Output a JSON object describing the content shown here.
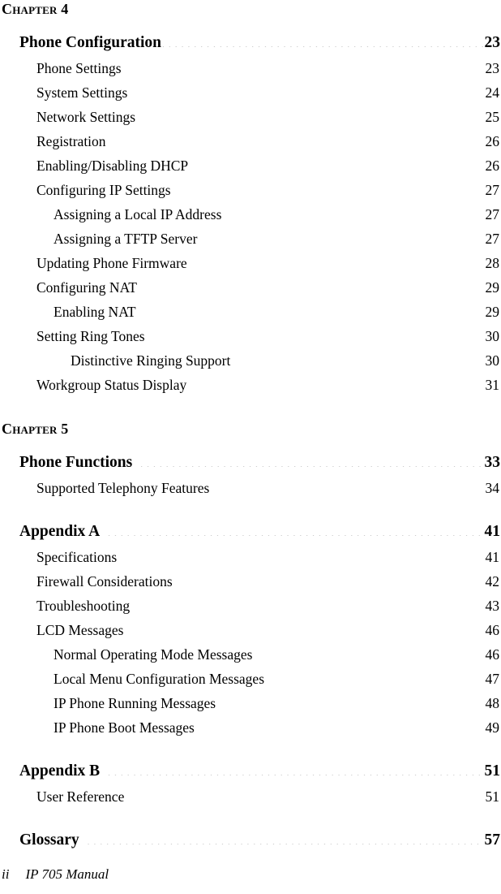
{
  "document": {
    "footer": {
      "page_number": "ii",
      "title": "IP 705 Manual"
    }
  },
  "toc": {
    "blocks": [
      {
        "chapter_label": "Chapter 4",
        "entries": [
          {
            "level": 0,
            "title": "Phone Configuration",
            "page": "23"
          },
          {
            "level": 1,
            "title": "Phone Settings",
            "page": "23"
          },
          {
            "level": 1,
            "title": "System Settings",
            "page": "24"
          },
          {
            "level": 1,
            "title": "Network Settings",
            "page": "25"
          },
          {
            "level": 1,
            "title": "Registration",
            "page": "26"
          },
          {
            "level": 1,
            "title": "Enabling/Disabling DHCP",
            "page": "26"
          },
          {
            "level": 1,
            "title": "Configuring IP Settings",
            "page": "27"
          },
          {
            "level": 2,
            "title": "Assigning a Local IP Address",
            "page": "27"
          },
          {
            "level": 2,
            "title": "Assigning a TFTP Server",
            "page": "27"
          },
          {
            "level": 1,
            "title": "Updating Phone Firmware",
            "page": "28"
          },
          {
            "level": 1,
            "title": "Configuring NAT",
            "page": "29"
          },
          {
            "level": 2,
            "title": "Enabling NAT",
            "page": "29"
          },
          {
            "level": 1,
            "title": "Setting Ring Tones",
            "page": "30"
          },
          {
            "level": 3,
            "title": "Distinctive Ringing Support",
            "page": "30"
          },
          {
            "level": 1,
            "title": "Workgroup Status Display",
            "page": "31"
          }
        ]
      },
      {
        "chapter_label": "Chapter 5",
        "entries": [
          {
            "level": 0,
            "title": "Phone Functions",
            "page": "33"
          },
          {
            "level": 1,
            "title": "Supported Telephony Features",
            "page": "34"
          }
        ]
      },
      {
        "chapter_label": null,
        "entries": [
          {
            "level": 0,
            "title": "Appendix A",
            "page": "41"
          },
          {
            "level": 1,
            "title": "Specifications",
            "page": "41"
          },
          {
            "level": 1,
            "title": "Firewall Considerations",
            "page": "42"
          },
          {
            "level": 1,
            "title": "Troubleshooting",
            "page": "43"
          },
          {
            "level": 1,
            "title": "LCD Messages",
            "page": "46"
          },
          {
            "level": 2,
            "title": "Normal Operating Mode Messages",
            "page": "46"
          },
          {
            "level": 2,
            "title": "Local Menu Configuration Messages",
            "page": "47"
          },
          {
            "level": 2,
            "title": "IP Phone Running Messages",
            "page": "48"
          },
          {
            "level": 2,
            "title": "IP Phone Boot Messages",
            "page": "49"
          }
        ]
      },
      {
        "chapter_label": null,
        "entries": [
          {
            "level": 0,
            "title": "Appendix B",
            "page": "51"
          },
          {
            "level": 1,
            "title": "User Reference",
            "page": "51"
          }
        ]
      },
      {
        "chapter_label": null,
        "entries": [
          {
            "level": 0,
            "title": "Glossary",
            "page": "57"
          }
        ]
      }
    ]
  }
}
